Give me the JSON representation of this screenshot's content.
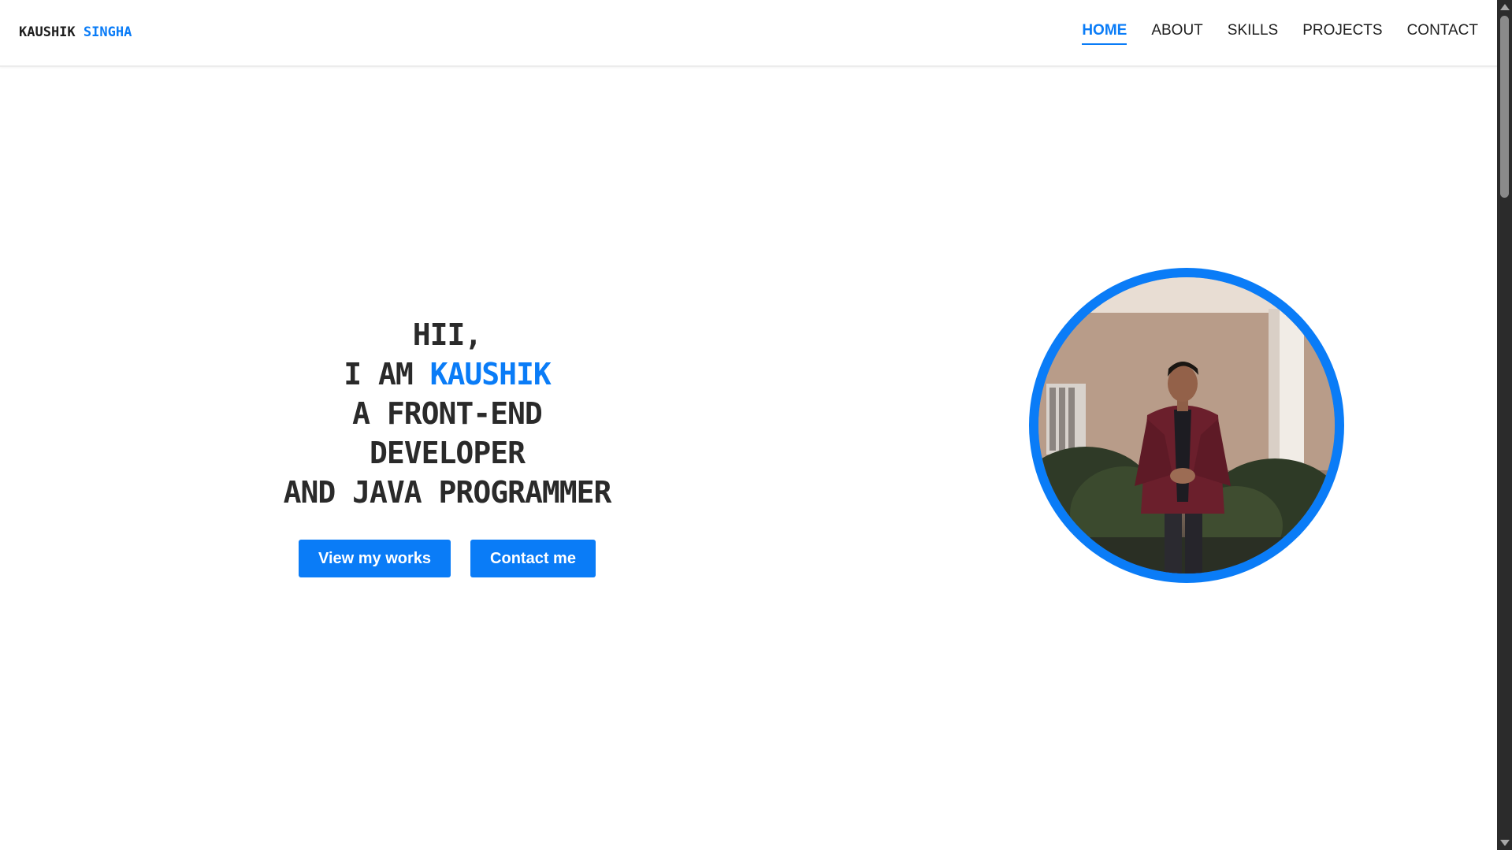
{
  "brand": {
    "first": "KAUSHIK",
    "last": "SINGHA"
  },
  "nav": {
    "items": [
      {
        "label": "HOME",
        "active": true
      },
      {
        "label": "ABOUT",
        "active": false
      },
      {
        "label": "SKILLS",
        "active": false
      },
      {
        "label": "PROJECTS",
        "active": false
      },
      {
        "label": "CONTACT",
        "active": false
      }
    ]
  },
  "hero": {
    "line1": "HII,",
    "line2_prefix": "I AM",
    "line2_name": "KAUSHIK",
    "line3": "A FRONT-END DEVELOPER",
    "line4": "AND JAVA PROGRAMMER",
    "buttons": {
      "works": "View my works",
      "contact": "Contact me"
    }
  },
  "colors": {
    "accent": "#0a7cf7",
    "text": "#2a2a2a"
  },
  "portrait": {
    "icon": "profile-photo"
  }
}
